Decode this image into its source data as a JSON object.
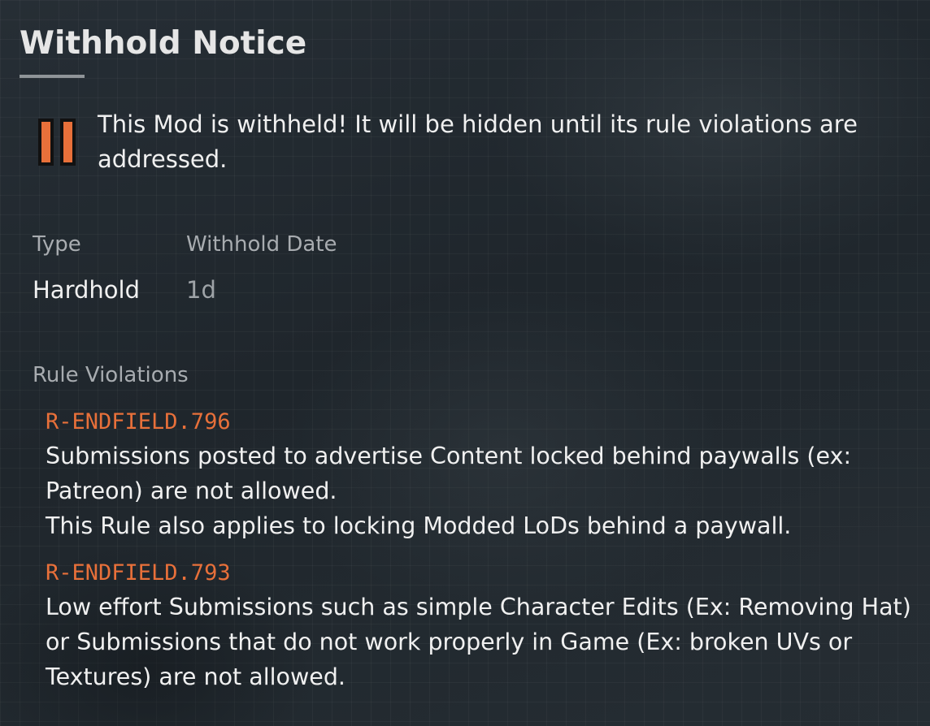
{
  "notice": {
    "title": "Withhold Notice",
    "icon": "pause-icon",
    "accent_color": "#e8703a",
    "message": "This Mod is withheld! It will be hidden until its rule violations are addressed."
  },
  "details": {
    "type_label": "Type",
    "type_value": "Hardhold",
    "date_label": "Withhold Date",
    "date_value": "1d"
  },
  "violations": {
    "label": "Rule Violations",
    "items": [
      {
        "code": "R-ENDFIELD.796",
        "description": "Submissions posted to advertise Content locked behind paywalls (ex: Patreon) are not allowed.\nThis Rule also applies to locking Modded LoDs behind a paywall."
      },
      {
        "code": "R-ENDFIELD.793",
        "description": "Low effort Submissions such as simple Character Edits (Ex: Removing Hat) or Submissions that do not work properly in Game (Ex: broken UVs or Textures) are not allowed."
      }
    ]
  }
}
